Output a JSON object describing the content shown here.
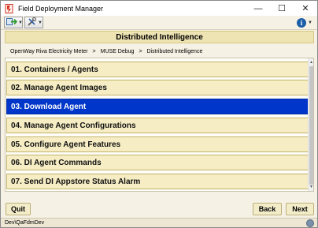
{
  "window": {
    "title": "Field Deployment Manager",
    "controls": {
      "minimize": "—",
      "maximize": "☐",
      "close": "✕"
    }
  },
  "toolbar": {
    "buttons": [
      {
        "icon": "exit-icon"
      },
      {
        "icon": "tools-icon"
      }
    ],
    "info_icon": "i"
  },
  "header": {
    "title": "Distributed Intelligence"
  },
  "breadcrumb": {
    "items": [
      "OpenWay Riva Electricity Meter",
      "MUSE Debug",
      "Distributed Intelligence"
    ],
    "separator": ">"
  },
  "menu": {
    "items": [
      {
        "label": "01. Containers / Agents",
        "selected": false
      },
      {
        "label": "02. Manage Agent Images",
        "selected": false
      },
      {
        "label": "03. Download Agent",
        "selected": true
      },
      {
        "label": "04. Manage Agent Configurations",
        "selected": false
      },
      {
        "label": "05. Configure Agent Features",
        "selected": false
      },
      {
        "label": "06. DI Agent Commands",
        "selected": false
      },
      {
        "label": "07. Send DI Appstore Status Alarm",
        "selected": false
      }
    ]
  },
  "buttons": {
    "quit": "Quit",
    "back": "Back",
    "next": "Next"
  },
  "status": {
    "text": "Dev\\QaFdmDev"
  },
  "colors": {
    "selected": "#0036c9",
    "item": "#f6edc4",
    "header": "#eee3b2"
  }
}
